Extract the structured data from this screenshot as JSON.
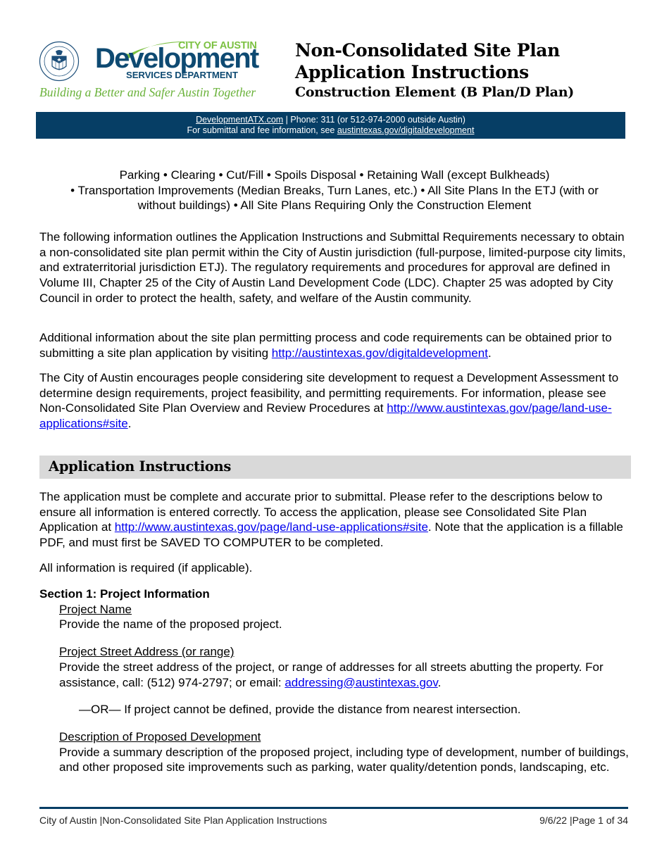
{
  "header": {
    "seal_label": "City of Austin seal",
    "brand_city": "CITY OF AUSTIN",
    "brand_name": "Development",
    "brand_dept": "SERVICES DEPARTMENT",
    "tagline": "Building a Better and Safer Austin Together",
    "title_line1": "Non-Consolidated Site Plan",
    "title_line2": "Application Instructions",
    "subtitle": "Construction Element (B Plan/D Plan)"
  },
  "banner": {
    "site_link": "DevelopmentATX.com",
    "phone_text": " |  Phone: 311 (or 512-974-2000 outside Austin)",
    "submittal_text": "For submittal and fee information, see ",
    "submittal_link": "austintexas.gov/digitaldevelopment"
  },
  "scope": {
    "line1": "Parking • Clearing • Cut/Fill • Spoils Disposal • Retaining Wall (except Bulkheads)",
    "line2": "• Transportation Improvements (Median Breaks, Turn Lanes, etc.) • All Site Plans In the ETJ (with or",
    "line3": "without buildings) • All Site Plans Requiring Only the Construction Element"
  },
  "intro": {
    "para1": "The following information outlines the Application Instructions and Submittal Requirements necessary to obtain a non-consolidated site plan permit within the City of Austin jurisdiction (full-purpose, limited-purpose city limits, and extraterritorial jurisdiction ETJ). The regulatory requirements and procedures for approval are defined in Volume III, Chapter 25 of the City of Austin Land Development Code (LDC). Chapter 25 was adopted by City Council in order to protect the health, safety, and welfare of the Austin community.",
    "para2_text": "Additional information about the site plan permitting process and code requirements can be obtained prior to submitting a site plan application by visiting ",
    "para2_link": "http://austintexas.gov/digitaldevelopment",
    "para2_end": ".",
    "para3_text": "The City of Austin encourages people considering site development to request a Development Assessment to determine design requirements, project feasibility, and permitting requirements. For information, please see Non-Consolidated Site Plan Overview and Review Procedures at ",
    "para3_link": "http://www.austintexas.gov/page/land-use-applications#site",
    "para3_end": "."
  },
  "instructions": {
    "heading": "Application Instructions",
    "para1_text": "The application must be complete and accurate prior to submittal. Please refer to the descriptions below to ensure all information is entered correctly. To access the application, please see Consolidated Site Plan Application at ",
    "para1_link": "http://www.austintexas.gov/page/land-use-applications#site",
    "para1_end": ". Note that the application is a fillable PDF, and must first be SAVED TO COMPUTER to be completed.",
    "para2": "All information is required (if applicable).",
    "section1_title": "Section 1: Project Information",
    "items": [
      {
        "label": "Project Name",
        "text": "Provide the name of the proposed project."
      },
      {
        "label": "Project Street Address (or range)",
        "text": "Provide the street address of the project, or range of addresses for all streets abutting the property. For assistance, call: (512) 974-2797; or email: ",
        "email": "addressing@austintexas.gov",
        "text_end": ".",
        "or_note": "—OR— If project cannot be defined, provide the distance from nearest intersection."
      },
      {
        "label": "Description of Proposed Development",
        "text": "Provide a summary description of the proposed project, including type of development, number of buildings, and other proposed site improvements such as parking, water quality/detention ponds, landscaping, etc."
      }
    ]
  },
  "footer": {
    "left": "City of Austin |Non-Consolidated Site Plan Application Instructions",
    "date": "9/6/22",
    "page": " |Page 1 of 34"
  },
  "colors": {
    "brand_blue": "#063e65",
    "brand_green": "#7cc142",
    "link_blue": "#0000ee",
    "section_gray": "#d9d9d9"
  }
}
